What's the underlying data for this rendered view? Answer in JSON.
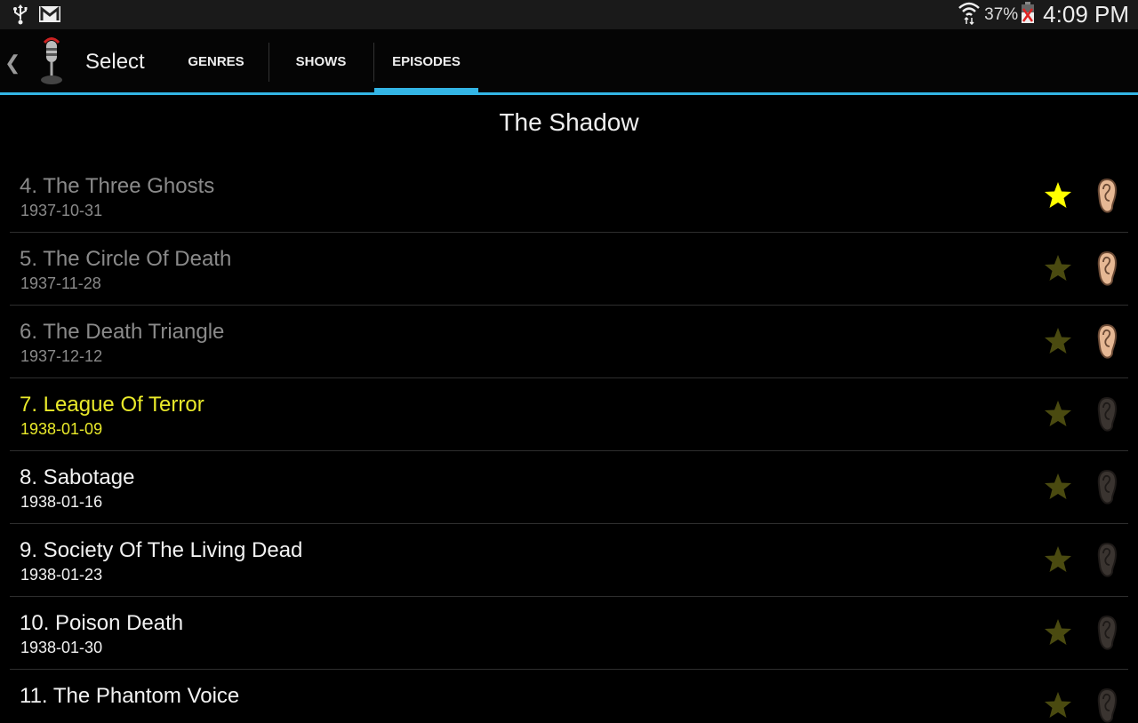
{
  "status_bar": {
    "left_icons": [
      "usb-icon",
      "gmail-icon"
    ],
    "wifi_icon": "wifi-icon",
    "battery_percent": "37%",
    "battery_icon": "battery-charging-error-icon",
    "time": "4:09 PM"
  },
  "action_bar": {
    "back_icon": "chevron-left-icon",
    "app_icon": "microphone-icon",
    "title": "Select",
    "tabs": [
      {
        "label": "GENRES",
        "selected": false
      },
      {
        "label": "SHOWS",
        "selected": false
      },
      {
        "label": "EPISODES",
        "selected": true
      }
    ],
    "accent_color": "#33b5e5"
  },
  "show_title": "The Shadow",
  "colors": {
    "played_text": "#8a8a8a",
    "current_text": "#eaea2a",
    "unplayed_text": "#f2f2f2",
    "favorite_star": "#ffff00",
    "not_favorite_star": "#4a4a10"
  },
  "episodes": [
    {
      "title": "4. The Three Ghosts",
      "date": "1937-10-31",
      "state": "played",
      "favorite": true,
      "listened": true
    },
    {
      "title": "5. The Circle Of Death",
      "date": "1937-11-28",
      "state": "played",
      "favorite": false,
      "listened": true
    },
    {
      "title": "6. The Death Triangle",
      "date": "1937-12-12",
      "state": "played",
      "favorite": false,
      "listened": true
    },
    {
      "title": "7. League Of Terror",
      "date": "1938-01-09",
      "state": "current",
      "favorite": false,
      "listened": false
    },
    {
      "title": "8. Sabotage",
      "date": "1938-01-16",
      "state": "unplayed",
      "favorite": false,
      "listened": false
    },
    {
      "title": "9. Society Of The Living Dead",
      "date": "1938-01-23",
      "state": "unplayed",
      "favorite": false,
      "listened": false
    },
    {
      "title": "10. Poison Death",
      "date": "1938-01-30",
      "state": "unplayed",
      "favorite": false,
      "listened": false
    },
    {
      "title": "11. The Phantom Voice",
      "date": "",
      "state": "unplayed",
      "favorite": false,
      "listened": false
    }
  ]
}
